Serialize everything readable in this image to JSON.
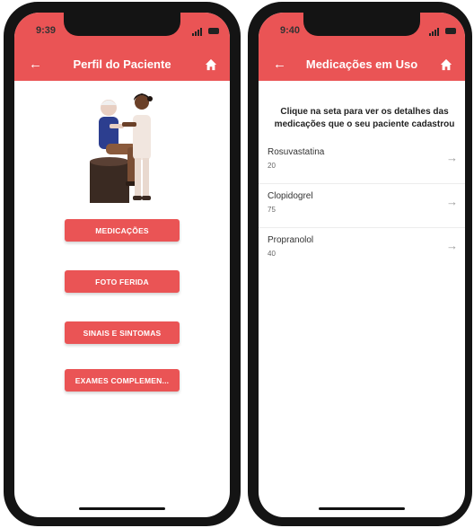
{
  "left_phone": {
    "time": "9:39",
    "title": "Perfil do Paciente",
    "back_icon": "back-arrow-icon",
    "home_icon": "home-icon",
    "buttons": [
      {
        "label": "MEDICAÇÕES"
      },
      {
        "label": "FOTO FERIDA"
      },
      {
        "label": "SINAIS E SINTOMAS"
      },
      {
        "label": "EXAMES COMPLEMEN..."
      }
    ]
  },
  "right_phone": {
    "time": "9:40",
    "title": "Medicações em Uso",
    "back_icon": "back-arrow-icon",
    "home_icon": "home-icon",
    "instruction": "Clique na seta para ver os detalhes das medicações que o seu paciente cadastrou",
    "medications": [
      {
        "name": "Rosuvastatina",
        "dose": "20"
      },
      {
        "name": "Clopidogrel",
        "dose": "75"
      },
      {
        "name": "Propranolol",
        "dose": "40"
      }
    ]
  },
  "colors": {
    "accent": "#ea5455",
    "frame": "#141414"
  }
}
